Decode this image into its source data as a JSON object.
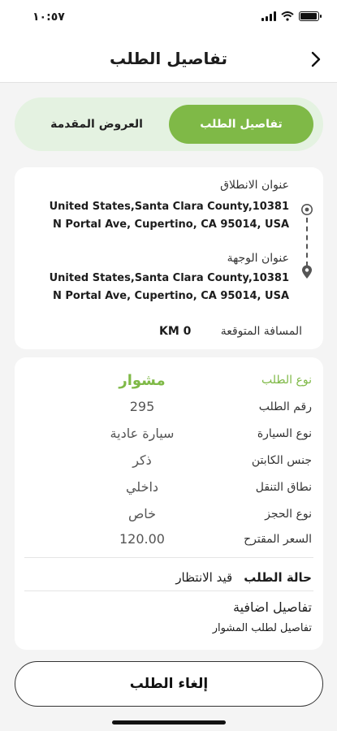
{
  "status_bar": {
    "time": "١٠:٥٧",
    "battery_level": 0.95
  },
  "header": {
    "title": "تفاصيل الطلب",
    "back_icon": "chevron-right-icon"
  },
  "segmented": {
    "active_label": "تفاصيل الطلب",
    "inactive_label": "العروض المقدمة"
  },
  "route": {
    "start_label": "عنوان الانطلاق",
    "start_address": "United States,Santa Clara County,10381 N Portal Ave, Cupertino, CA 95014, USA",
    "dest_label": "عنوان الوجهة",
    "dest_address": "United States,Santa Clara County,10381 N Portal Ave, Cupertino, CA 95014, USA",
    "distance_label": "المسافة المتوقعة",
    "distance_value": "KM 0"
  },
  "details": {
    "rows": [
      {
        "label": "نوع الطلب",
        "value": "مشوار"
      },
      {
        "label": "رقم الطلب",
        "value": "295"
      },
      {
        "label": "نوع السيارة",
        "value": "سيارة عادية"
      },
      {
        "label": "جنس الكابتن",
        "value": "ذكر"
      },
      {
        "label": "نطاق التنقل",
        "value": "داخلي"
      },
      {
        "label": "نوع الحجز",
        "value": "خاص"
      },
      {
        "label": "السعر المقترح",
        "value": "120.00"
      }
    ],
    "status_label": "حالة الطلب",
    "status_value": "قيد الانتظار",
    "extra_title": "تفاصيل اضافية",
    "extra_text": "تفاصيل لطلب المشوار"
  },
  "cancel_button": {
    "label": "إلغاء الطلب"
  },
  "colors": {
    "accent": "#7fb947",
    "segment_bg": "#e4f2e1",
    "page_bg": "#f4f4f4"
  }
}
